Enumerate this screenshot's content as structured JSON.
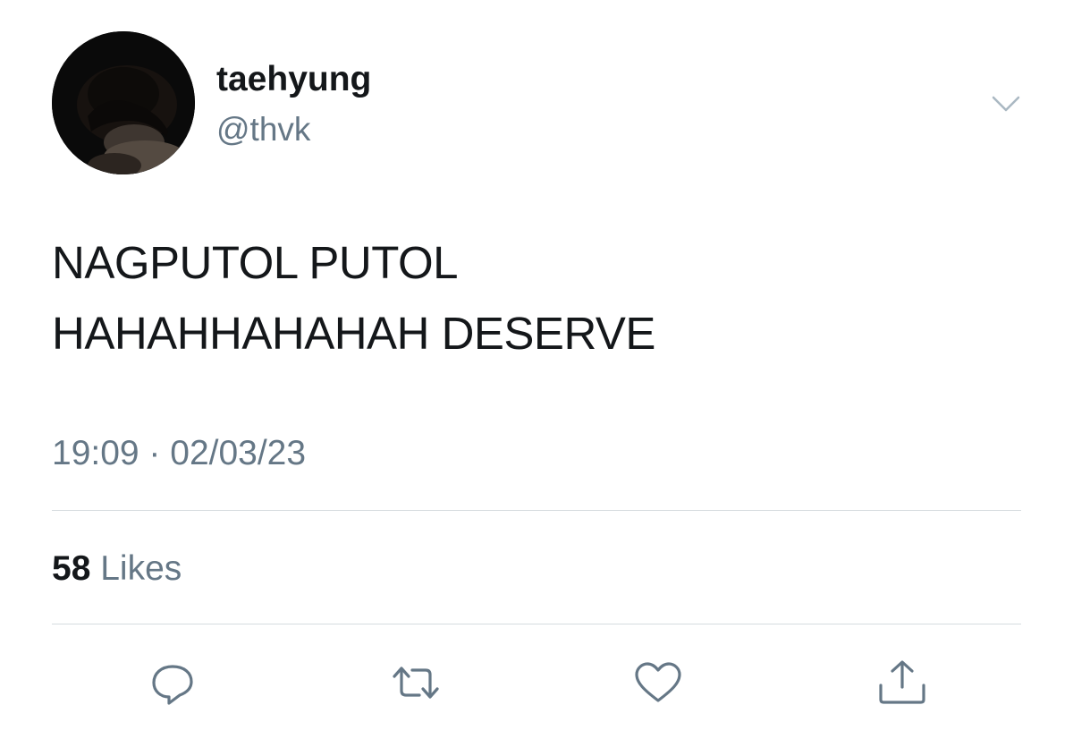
{
  "user": {
    "display_name": "taehyung",
    "handle": "@thvk"
  },
  "tweet": {
    "lines": [
      "NAGPUTOL PUTOL",
      "HAHAHHAHAHAH DESERVE"
    ],
    "timestamp": "19:09 · 02/03/23"
  },
  "stats": {
    "likes_count": "58",
    "likes_label": "Likes"
  },
  "actions": {
    "icons": [
      "reply-icon",
      "retweet-icon",
      "like-icon",
      "share-icon"
    ]
  },
  "colors": {
    "text": "#14171a",
    "secondary": "#657786",
    "divider": "#d6dbdf"
  }
}
